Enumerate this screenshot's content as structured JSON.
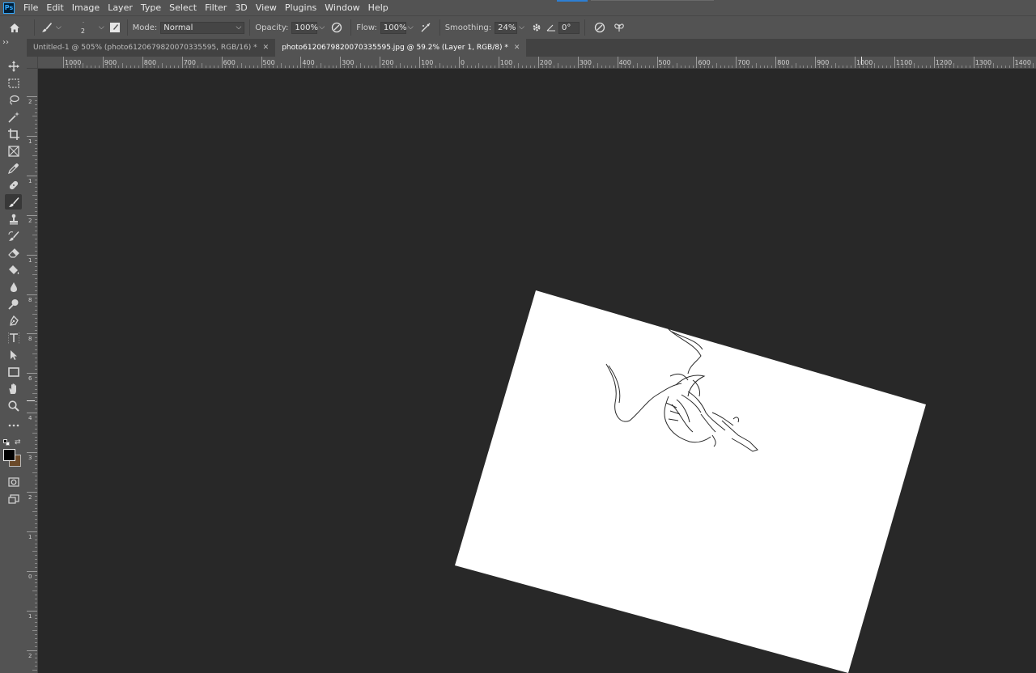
{
  "app": {
    "logo": "Ps"
  },
  "menu": [
    "File",
    "Edit",
    "Image",
    "Layer",
    "Type",
    "Select",
    "Filter",
    "3D",
    "View",
    "Plugins",
    "Window",
    "Help"
  ],
  "options": {
    "brush_size": "2",
    "mode_label": "Mode:",
    "mode_value": "Normal",
    "opacity_label": "Opacity:",
    "opacity_value": "100%",
    "flow_label": "Flow:",
    "flow_value": "100%",
    "smoothing_label": "Smoothing:",
    "smoothing_value": "24%",
    "angle_value": "0°"
  },
  "tabs": [
    {
      "label": "Untitled-1 @ 505% (photo6120679820070335595, RGB/16) *",
      "active": false
    },
    {
      "label": "photo6120679820070335595.jpg @ 59.2% (Layer 1, RGB/8) *",
      "active": true
    }
  ],
  "ruler": {
    "horizontal": [
      "1000",
      "900",
      "800",
      "700",
      "600",
      "500",
      "400",
      "300",
      "200",
      "100",
      "0",
      "100",
      "200",
      "300",
      "400",
      "500",
      "600",
      "700",
      "800",
      "900",
      "1000",
      "1100",
      "1200",
      "1300",
      "1400"
    ],
    "vertical": [
      "2",
      "1",
      "1",
      "2",
      "1",
      "8",
      "8",
      "6",
      "4",
      "3",
      "2",
      "1",
      "0",
      "1",
      "2",
      "3",
      "4",
      "5",
      "6",
      "7",
      "8",
      "9",
      "0"
    ]
  },
  "colors": {
    "foreground": "#000000",
    "background": "#6b4a2a",
    "accent": "#31a8ff"
  },
  "tools": [
    "move-tool-icon",
    "marquee-tool-icon",
    "lasso-tool-icon",
    "magic-wand-icon",
    "crop-tool-icon",
    "frame-tool-icon",
    "eyedropper-icon",
    "healing-brush-icon",
    "brush-tool-icon",
    "clone-stamp-icon",
    "history-brush-icon",
    "eraser-icon",
    "paint-bucket-icon",
    "blur-tool-icon",
    "dodge-tool-icon",
    "pen-tool-icon",
    "type-tool-icon",
    "path-selection-icon",
    "rectangle-tool-icon",
    "hand-tool-icon",
    "zoom-tool-icon",
    "more-tools-icon"
  ]
}
